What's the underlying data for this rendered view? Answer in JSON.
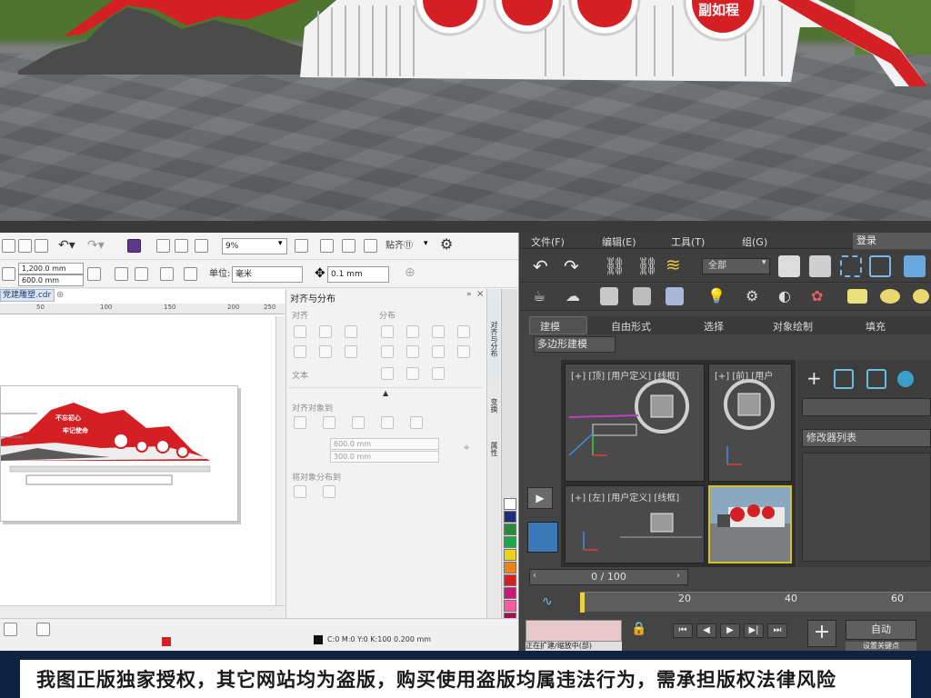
{
  "scene": {
    "sign_text": "副如程",
    "colors": {
      "red": "#d41f24",
      "dark": "#4a4a4a",
      "white": "#f4f4f4",
      "grass": "#4d6f2e"
    }
  },
  "corel": {
    "zoom_value": "9%",
    "size_width": "1,200.0 mm",
    "size_height": "600.0 mm",
    "units_label": "单位:",
    "units_value": "毫米",
    "nudge_value": "0.1 mm",
    "align_mode_label": "贴齐⑪",
    "doc_tab": "党建雕塑.cdr",
    "ruler_ticks": [
      "50",
      "100",
      "150",
      "200",
      "250"
    ],
    "dock": {
      "title": "对齐与分布",
      "align_label": "对齐",
      "distribute_label": "分布",
      "text_label": "文本",
      "align_objects_label": "对齐对象到",
      "field_x": "600.0 mm",
      "field_y": "300.0 mm",
      "distribute_to_label": "将对象分布到"
    },
    "side_tabs": [
      "对齐与分布",
      "变换",
      "属性"
    ],
    "design": {
      "line1": "不忘初心",
      "line2": "牢记使命"
    },
    "palette": [
      "#ffffff",
      "#1f2d7a",
      "#2a8a3a",
      "#1aa84a",
      "#e8d51a",
      "#e8841a",
      "#d41f24",
      "#c8197a",
      "#ff5aa0",
      "#a01050"
    ],
    "status": "C:0 M:0 Y:0 K:100  0.200 mm"
  },
  "max": {
    "menu": [
      "文件(F)",
      "编辑(E)",
      "工具(T)",
      "组(G)"
    ],
    "login": "登录",
    "all_select": "全部",
    "ribbon_tabs": [
      "建模",
      "自由形式",
      "选择",
      "对象绘制",
      "填充"
    ],
    "poly_label": "多边形建模",
    "viewports": [
      {
        "label": "[+] [顶] [用户定义] [线框]"
      },
      {
        "label": "[+] [前] [用户"
      },
      {
        "label": "[+] [左] [用户定义] [线框]"
      },
      {
        "label": ""
      }
    ],
    "modifier_list": "修改器列表",
    "time_slider": "0 / 100",
    "track_numbers": [
      "20",
      "40",
      "60"
    ],
    "auto_key": "自动",
    "set_key": "设置关键点",
    "status_text": "正在扩建/缩放中(部)"
  },
  "banner": {
    "text": "我图正版独家授权，其它网站均为盗版，购买使用盗版均属违法行为，需承担版权法律风险"
  }
}
